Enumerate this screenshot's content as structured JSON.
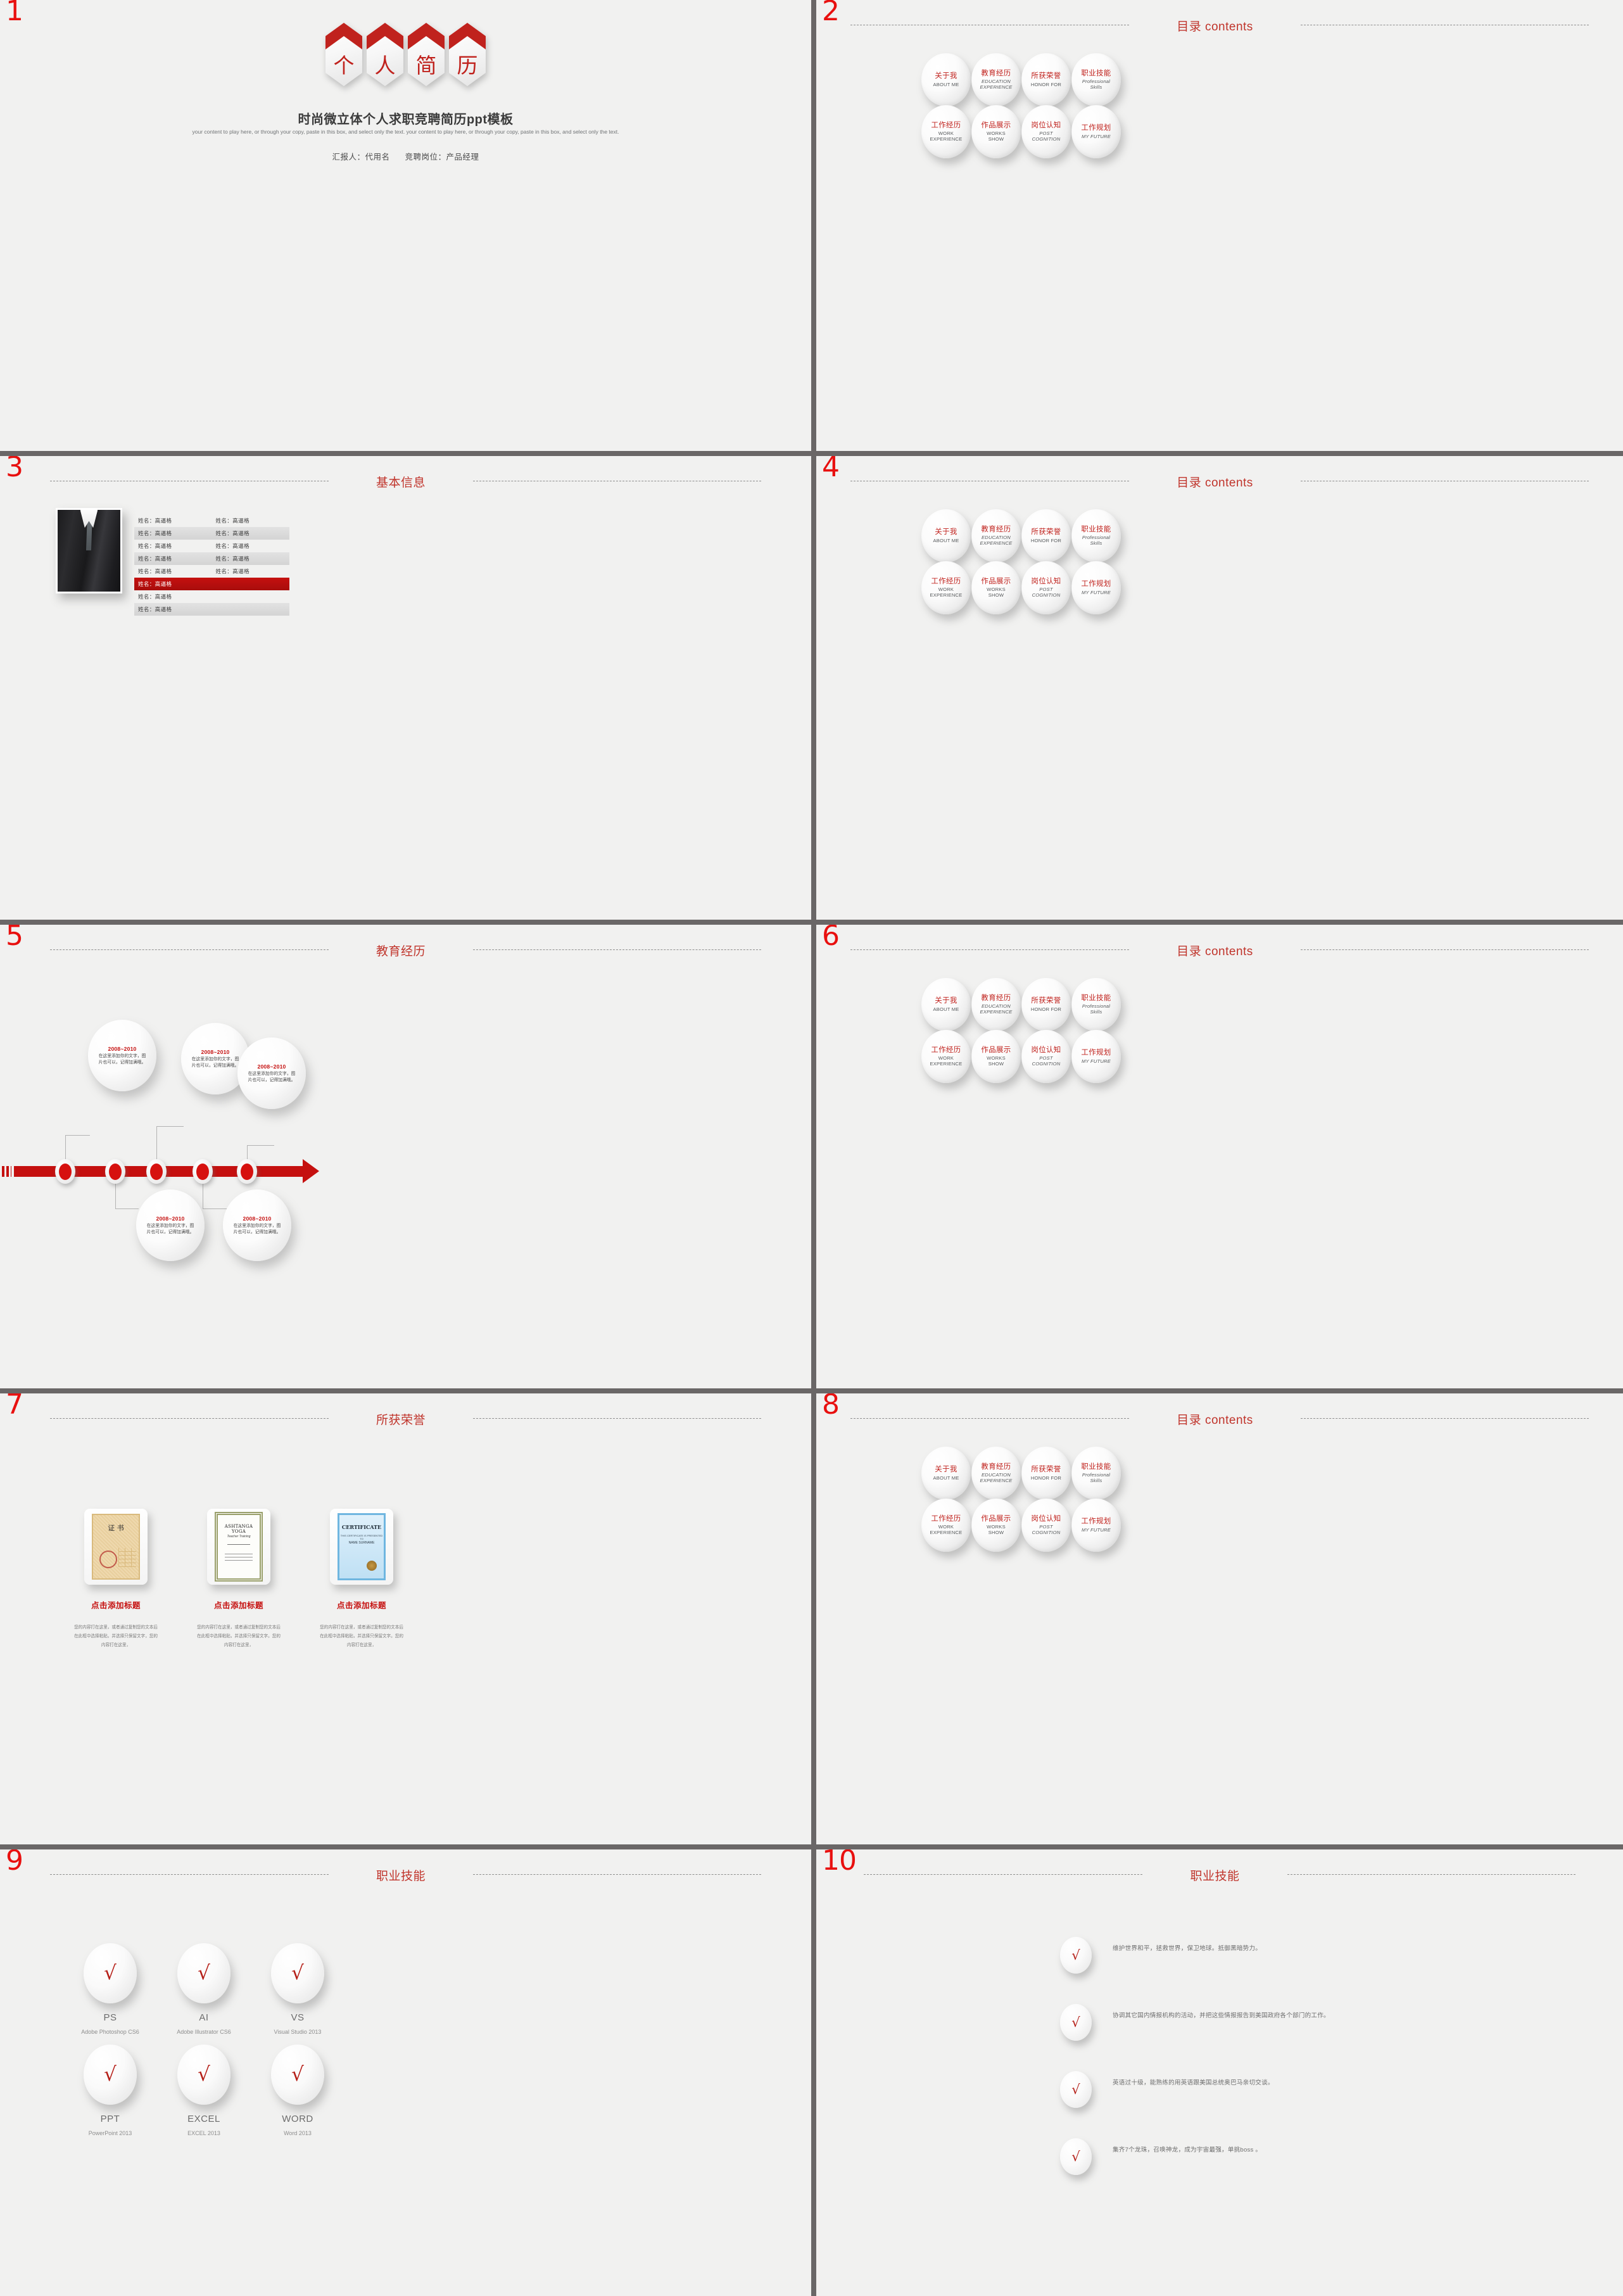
{
  "colors": {
    "accent_red": "#c5100f",
    "title_red": "#c0342b",
    "num_red": "#e8100f",
    "bg": "#f1f1f0",
    "divider": "#6a6767"
  },
  "slides": [
    {
      "number": "1"
    },
    {
      "number": "2",
      "title": "目录 contents"
    },
    {
      "number": "3",
      "title": "基本信息"
    },
    {
      "number": "4",
      "title": "目录 contents"
    },
    {
      "number": "5",
      "title": "教育经历"
    },
    {
      "number": "6",
      "title": "目录 contents"
    },
    {
      "number": "7",
      "title": "所获荣誉"
    },
    {
      "number": "8",
      "title": "目录 contents"
    },
    {
      "number": "9",
      "title": "职业技能"
    },
    {
      "number": "10",
      "title": "职业技能"
    }
  ],
  "title_slide": {
    "hex_chars": [
      "个",
      "人",
      "简",
      "历"
    ],
    "main_title": "时尚微立体个人求职竞聘简历ppt模板",
    "sub_text": "your content to play here, or through your copy, paste in this box, and select only the text. your content to play here, or through your copy, paste in this box, and select only the text.",
    "presenter": "汇报人：代用名",
    "position": "竞聘岗位：产品经理"
  },
  "toc": {
    "items": [
      {
        "cn": "关于我",
        "en": "ABOUT ME",
        "italic": false
      },
      {
        "cn": "教育经历",
        "en": "EDUCATION\nEXPERIENCE",
        "italic": true
      },
      {
        "cn": "所获荣誉",
        "en": "HONOR FOR",
        "italic": false
      },
      {
        "cn": "职业技能",
        "en": "Professional\nSkills",
        "italic": true
      },
      {
        "cn": "工作经历",
        "en": "WORK\nEXPERIENCE",
        "italic": false
      },
      {
        "cn": "作品展示",
        "en": "WORKS\nSHOW",
        "italic": false
      },
      {
        "cn": "岗位认知",
        "en": "POST\nCOGNITION",
        "italic": true
      },
      {
        "cn": "工作规划",
        "en": "MY FUTURE",
        "italic": true
      }
    ]
  },
  "basic_info": {
    "rows": [
      {
        "left": "姓名：高逼格",
        "right": "姓名：高逼格",
        "style": "plain"
      },
      {
        "left": "姓名：高逼格",
        "right": "姓名：高逼格",
        "style": "alt"
      },
      {
        "left": "姓名：高逼格",
        "right": "姓名：高逼格",
        "style": "plain"
      },
      {
        "left": "姓名：高逼格",
        "right": "姓名：高逼格",
        "style": "alt"
      },
      {
        "left": "姓名：高逼格",
        "right": "姓名：高逼格",
        "style": "plain"
      },
      {
        "left": "姓名：高逼格",
        "right": "",
        "style": "hl"
      },
      {
        "left": "姓名：高逼格",
        "right": "",
        "style": "plain"
      },
      {
        "left": "姓名：高逼格",
        "right": "",
        "style": "alt"
      }
    ]
  },
  "education": {
    "bubbles": [
      {
        "year": "2008~2010",
        "text": "在这里添加你的文字，图片也可以，记得加满哦。"
      },
      {
        "year": "2008~2010",
        "text": "在这里添加你的文字，图片也可以，记得加满哦。"
      },
      {
        "year": "2008~2010",
        "text": "在这里添加你的文字，图片也可以，记得加满哦。"
      },
      {
        "year": "2008~2010",
        "text": "在这里添加你的文字，图片也可以，记得加满哦。"
      },
      {
        "year": "2008~2010",
        "text": "在这里添加你的文字，图片也可以，记得加满哦。"
      }
    ]
  },
  "honors": {
    "cards": [
      {
        "cert_label": "证 书",
        "title": "点击添加标题",
        "body": "您的内容打在这里，或者通过复制您的文本后在此框中选择粘贴，并选择只保留文字，您的内容打在这里，"
      },
      {
        "cert_label": "ASHTANGA YOGA",
        "cert_sub": "Teacher Training",
        "title": "点击添加标题",
        "body": "您的内容打在这里，或者通过复制您的文本后在此框中选择粘贴，并选择只保留文字。您的内容打在这里，"
      },
      {
        "cert_label": "CERTIFICATE",
        "cert_sub": "THIS CERTIFICATE IS PRESENTED TO",
        "cert_name": "NAME SURNAME",
        "title": "点击添加标题",
        "body": "您的内容打在这里，或者通过复制您的文本后在此框中选择粘贴，并选择只保留文字。您的内容打在这里，"
      }
    ]
  },
  "skills_icons": {
    "items": [
      {
        "name": "PS",
        "desc": "Adobe Photoshop CS6"
      },
      {
        "name": "AI",
        "desc": "Adobe Illustrator CS6"
      },
      {
        "name": "VS",
        "desc": "Visual Studio 2013"
      },
      {
        "name": "PPT",
        "desc": "PowerPoint 2013"
      },
      {
        "name": "EXCEL",
        "desc": "EXCEL 2013"
      },
      {
        "name": "WORD",
        "desc": "Word 2013"
      }
    ]
  },
  "skills_list": {
    "items": [
      "维护世界和平，拯救世界，保卫地球。抵御黑暗势力。",
      "协调其它国内情报机构的活动，并把这些情报报告到美国政府各个部门的工作。",
      "英语过十级，能熟练的用英语跟美国总统奥巴马亲切交谈。",
      "集齐7个龙珠，召唤神龙，成为宇宙最强，单挑boss 。"
    ]
  },
  "icons": {
    "check": "√"
  }
}
